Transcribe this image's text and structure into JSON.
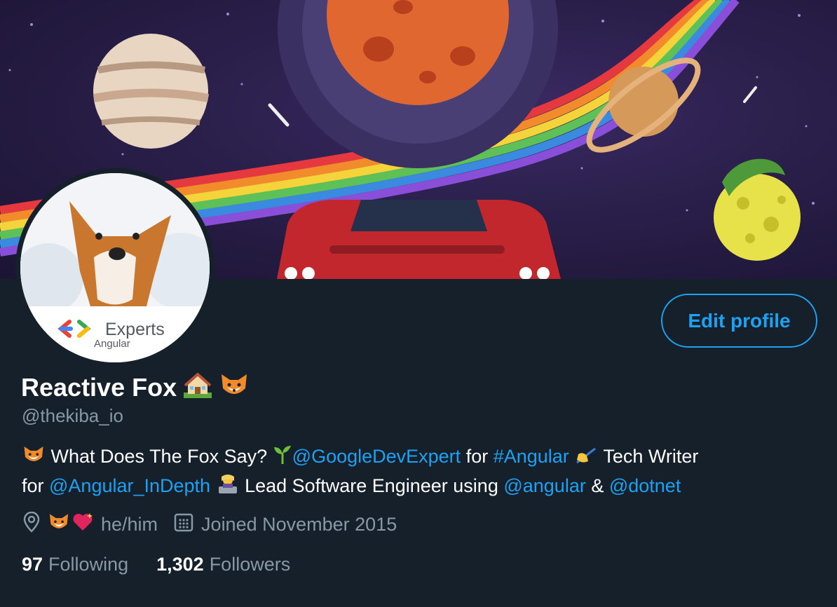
{
  "profile": {
    "display_name": "Reactive Fox",
    "handle": "@thekiba_io",
    "edit_profile_label": "Edit profile",
    "avatar_badge": {
      "title": "Experts",
      "subtitle": "Angular"
    },
    "bio": {
      "line1": [
        {
          "text": " What Does The Fox Say? ",
          "type": "text"
        },
        {
          "text": "@GoogleDevExpert",
          "type": "link"
        },
        {
          "text": " for ",
          "type": "text"
        },
        {
          "text": "#Angular",
          "type": "link"
        },
        {
          "text": " Tech Writer",
          "type": "text"
        }
      ],
      "line2": [
        {
          "text": "for ",
          "type": "text"
        },
        {
          "text": "@Angular_InDepth",
          "type": "link"
        },
        {
          "text": " Lead Software Engineer using ",
          "type": "text"
        },
        {
          "text": "@angular",
          "type": "link"
        },
        {
          "text": " & ",
          "type": "text"
        },
        {
          "text": "@dotnet",
          "type": "link"
        }
      ]
    },
    "location": "he/him",
    "joined": "Joined November 2015",
    "following_count": "97",
    "following_label": "Following",
    "followers_count": "1,302",
    "followers_label": "Followers"
  },
  "icons": [
    "location-pin-icon",
    "calendar-icon",
    "fox-emoji-icon",
    "house-emoji-icon",
    "seedling-emoji-icon",
    "writing-hand-emoji-icon",
    "technologist-emoji-icon",
    "sparkling-heart-emoji-icon"
  ],
  "colors": {
    "background": "#15202b",
    "accent": "#1da1f2",
    "secondary_text": "#8899a6",
    "primary_text": "#ffffff"
  }
}
